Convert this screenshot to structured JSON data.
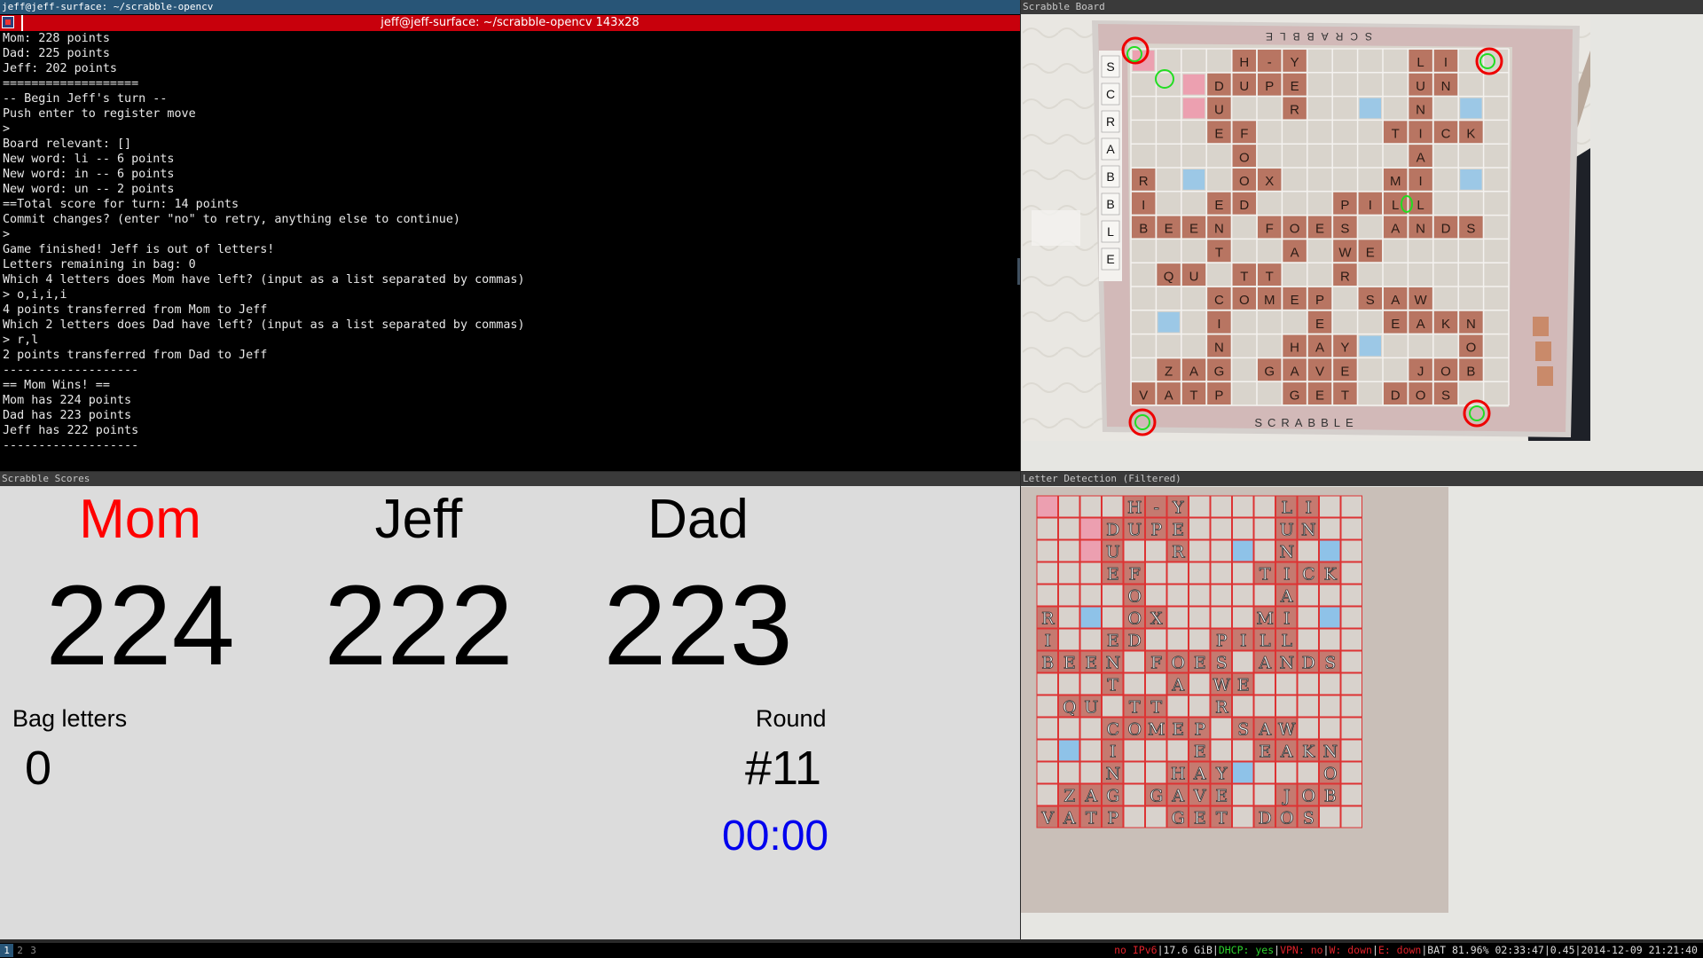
{
  "terminal": {
    "title": "jeff@jeff-surface: ~/scrabble-opencv",
    "tab_title": "jeff@jeff-surface: ~/scrabble-opencv 143x28",
    "lines": [
      "Mom: 228 points",
      "Dad: 225 points",
      "Jeff: 202 points",
      "===================",
      "-- Begin Jeff's turn --",
      "Push enter to register move",
      ">",
      "Board relevant: []",
      "New word: li -- 6 points",
      "New word: in -- 6 points",
      "New word: un -- 2 points",
      "==Total score for turn: 14 points",
      "Commit changes? (enter \"no\" to retry, anything else to continue)",
      ">",
      "Game finished! Jeff is out of letters!",
      "Letters remaining in bag: 0",
      "Which 4 letters does Mom have left? (input as a list separated by commas)",
      "> o,i,i,i",
      "4 points transferred from Mom to Jeff",
      "Which 2 letters does Dad have left? (input as a list separated by commas)",
      "> r,l",
      "2 points transferred from Dad to Jeff",
      "-------------------",
      "== Mom Wins! ==",
      "Mom has 224 points",
      "Dad has 223 points",
      "Jeff has 222 points",
      "-------------------"
    ]
  },
  "board_window": {
    "title": "Scrabble Board",
    "side_letters": [
      "S",
      "C",
      "R",
      "A",
      "B",
      "B",
      "L",
      "E"
    ]
  },
  "scores_window": {
    "title": "Scrabble Scores",
    "players": [
      {
        "name": "Mom",
        "score": "224",
        "color": "#ff0000"
      },
      {
        "name": "Jeff",
        "score": "222",
        "color": "#000000"
      },
      {
        "name": "Dad",
        "score": "223",
        "color": "#000000"
      }
    ],
    "bag_label": "Bag letters",
    "bag_value": "0",
    "round_label": "Round",
    "round_value": "#11",
    "timer": "00:00",
    "timer_color": "#0000ee"
  },
  "detection_window": {
    "title": "Letter Detection (Filtered)",
    "grid": [
      "    H-Y    LI",
      "   DUPE    UN",
      "   U  R    N ",
      "   EF     TICK",
      "    O      A ",
      "R   OX    MI ",
      "I  ED   PILL ",
      "BEEN FOES ANDS",
      "   T  A WE   ",
      " QU TT  R    ",
      "   COMEP SAW ",
      "   I   E  EAKN",
      "   N  HAY    O",
      " ZAG GAVE  JOB",
      "VATP  GET DOS"
    ]
  },
  "taskbar": {
    "workspaces": [
      "1",
      "2",
      "3"
    ],
    "active_workspace": "1",
    "status": [
      {
        "text": "no IPv6",
        "color": "red"
      },
      {
        "text": "|",
        "color": "white"
      },
      {
        "text": "17.6 GiB",
        "color": "white"
      },
      {
        "text": "|",
        "color": "white"
      },
      {
        "text": "DHCP: yes",
        "color": "green"
      },
      {
        "text": "|",
        "color": "white"
      },
      {
        "text": "VPN: no",
        "color": "red"
      },
      {
        "text": "|",
        "color": "white"
      },
      {
        "text": "W: down",
        "color": "red"
      },
      {
        "text": "|",
        "color": "white"
      },
      {
        "text": "E: down",
        "color": "red"
      },
      {
        "text": "|",
        "color": "white"
      },
      {
        "text": "BAT 81.96% 02:33:47",
        "color": "white"
      },
      {
        "text": "|",
        "color": "white"
      },
      {
        "text": "0.45",
        "color": "white"
      },
      {
        "text": "|",
        "color": "white"
      },
      {
        "text": "2014-12-09 21:21:40",
        "color": "white"
      }
    ]
  }
}
